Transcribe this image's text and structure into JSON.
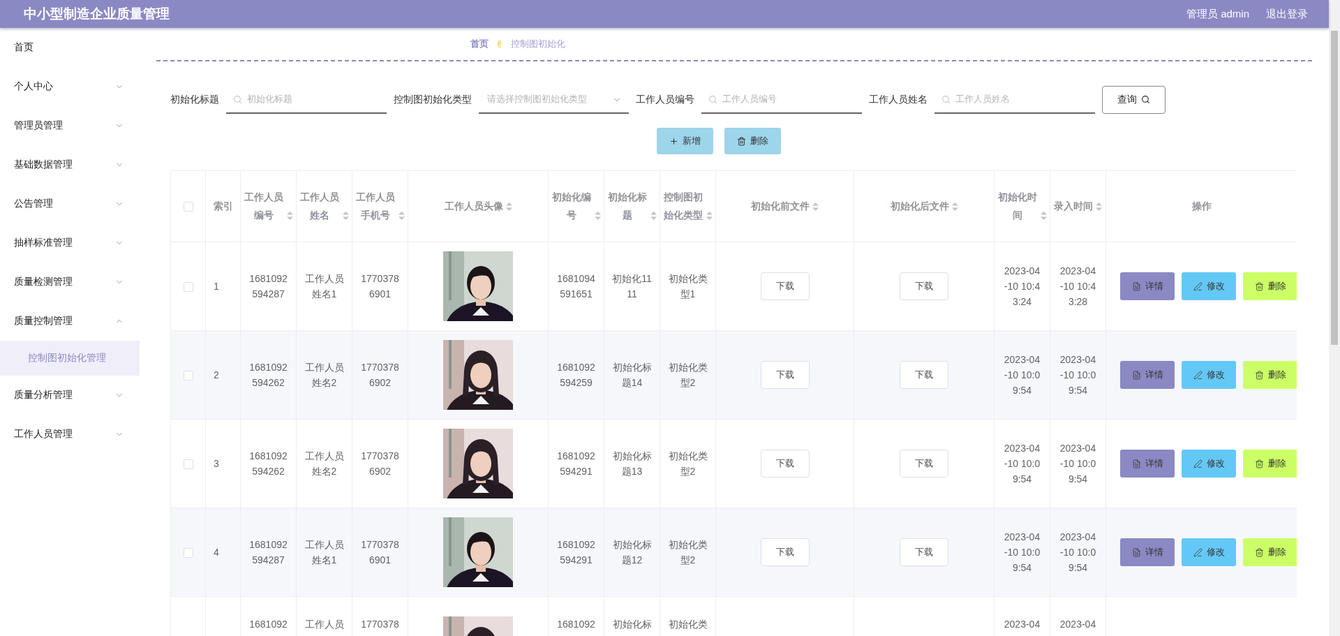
{
  "header": {
    "title": "中小型制造企业质量管理",
    "user": "管理员 admin",
    "logout": "退出登录"
  },
  "sidebar": {
    "items": [
      {
        "label": "首页",
        "expandable": false
      },
      {
        "label": "个人中心",
        "expandable": true,
        "expanded": false
      },
      {
        "label": "管理员管理",
        "expandable": true,
        "expanded": false
      },
      {
        "label": "基础数据管理",
        "expandable": true,
        "expanded": false
      },
      {
        "label": "公告管理",
        "expandable": true,
        "expanded": false
      },
      {
        "label": "抽样标准管理",
        "expandable": true,
        "expanded": false
      },
      {
        "label": "质量检测管理",
        "expandable": true,
        "expanded": false
      },
      {
        "label": "质量控制管理",
        "expandable": true,
        "expanded": true,
        "children": [
          {
            "label": "控制图初始化管理",
            "selected": true
          }
        ]
      },
      {
        "label": "质量分析管理",
        "expandable": true,
        "expanded": false
      },
      {
        "label": "工作人员管理",
        "expandable": true,
        "expanded": false
      }
    ]
  },
  "breadcrumb": {
    "home": "首页",
    "icon": "✌",
    "current": "控制图初始化"
  },
  "search": {
    "fields": [
      {
        "kind": "input",
        "label": "初始化标题",
        "placeholder": "初始化标题"
      },
      {
        "kind": "select",
        "label": "控制图初始化类型",
        "placeholder": "请选择控制图初始化类型"
      },
      {
        "kind": "input",
        "label": "工作人员编号",
        "placeholder": "工作人员编号"
      },
      {
        "kind": "input",
        "label": "工作人员姓名",
        "placeholder": "工作人员姓名"
      }
    ],
    "button": "查询"
  },
  "toolbar": [
    {
      "kind": "add",
      "label": "新增"
    },
    {
      "kind": "delete",
      "label": "删除"
    }
  ],
  "table": {
    "header_checked": false,
    "columns": [
      {
        "kind": "index",
        "label": "索引",
        "sortable": false
      },
      {
        "kind": "text",
        "label": "工作人员编号",
        "sortable": true
      },
      {
        "kind": "text",
        "label": "工作人员姓名",
        "sortable": true
      },
      {
        "kind": "text",
        "label": "工作人员手机号",
        "sortable": true
      },
      {
        "kind": "picture",
        "label": "工作人员头像",
        "sortable": true
      },
      {
        "kind": "text",
        "label": "初始化编号",
        "sortable": true
      },
      {
        "kind": "text",
        "label": "初始化标题",
        "sortable": true
      },
      {
        "kind": "text",
        "label": "控制图初始化类型",
        "sortable": true
      },
      {
        "kind": "file",
        "label": "初始化前文件",
        "sortable": true
      },
      {
        "kind": "file",
        "label": "初始化后文件",
        "sortable": true
      },
      {
        "kind": "datetime",
        "label": "初始化时间",
        "sortable": true
      },
      {
        "kind": "datetime",
        "label": "录入时间",
        "sortable": true
      },
      {
        "kind": "actions",
        "label": "操作",
        "sortable": false
      }
    ],
    "rows": [
      {
        "checked": false,
        "truncated": false,
        "cells": [
          "1",
          "1681092594287",
          "工作人员姓名1",
          "17703786901",
          {
            "kind": "picture"
          },
          "1681094591651",
          "初始化1111",
          "初始化类型1",
          {
            "button": "下载"
          },
          {
            "button": "下载"
          },
          "2023-04-10 10:43:24",
          "2023-04-10 10:43:28",
          [
            {
              "kind": "detail",
              "label": "详情"
            },
            {
              "kind": "edit",
              "label": "修改"
            },
            {
              "kind": "delete",
              "label": "删除"
            }
          ]
        ]
      },
      {
        "checked": false,
        "truncated": false,
        "cells": [
          "2",
          "1681092594262",
          "工作人员姓名2",
          "17703786902",
          {
            "kind": "picture"
          },
          "1681092594259",
          "初始化标题14",
          "初始化类型2",
          {
            "button": "下载"
          },
          {
            "button": "下载"
          },
          "2023-04-10 10:09:54",
          "2023-04-10 10:09:54",
          [
            {
              "kind": "detail",
              "label": "详情"
            },
            {
              "kind": "edit",
              "label": "修改"
            },
            {
              "kind": "delete",
              "label": "删除"
            }
          ]
        ]
      },
      {
        "checked": false,
        "truncated": false,
        "cells": [
          "3",
          "1681092594262",
          "工作人员姓名2",
          "17703786902",
          {
            "kind": "picture"
          },
          "1681092594291",
          "初始化标题13",
          "初始化类型2",
          {
            "button": "下载"
          },
          {
            "button": "下载"
          },
          "2023-04-10 10:09:54",
          "2023-04-10 10:09:54",
          [
            {
              "kind": "detail",
              "label": "详情"
            },
            {
              "kind": "edit",
              "label": "修改"
            },
            {
              "kind": "delete",
              "label": "删除"
            }
          ]
        ]
      },
      {
        "checked": false,
        "truncated": false,
        "cells": [
          "4",
          "1681092594287",
          "工作人员姓名1",
          "17703786901",
          {
            "kind": "picture"
          },
          "1681092594291",
          "初始化标题12",
          "初始化类型2",
          {
            "button": "下载"
          },
          {
            "button": "下载"
          },
          "2023-04-10 10:09:54",
          "2023-04-10 10:09:54",
          [
            {
              "kind": "detail",
              "label": "详情"
            },
            {
              "kind": "edit",
              "label": "修改"
            },
            {
              "kind": "delete",
              "label": "删除"
            }
          ]
        ]
      },
      {
        "truncated": true,
        "cells": [
          null,
          "1681092",
          "工作人员",
          "1770378",
          {
            "kind": "picture"
          },
          "1681092",
          "初始化标",
          "初始化类",
          null,
          null,
          "2023-04",
          "2023-04",
          null
        ]
      }
    ]
  }
}
